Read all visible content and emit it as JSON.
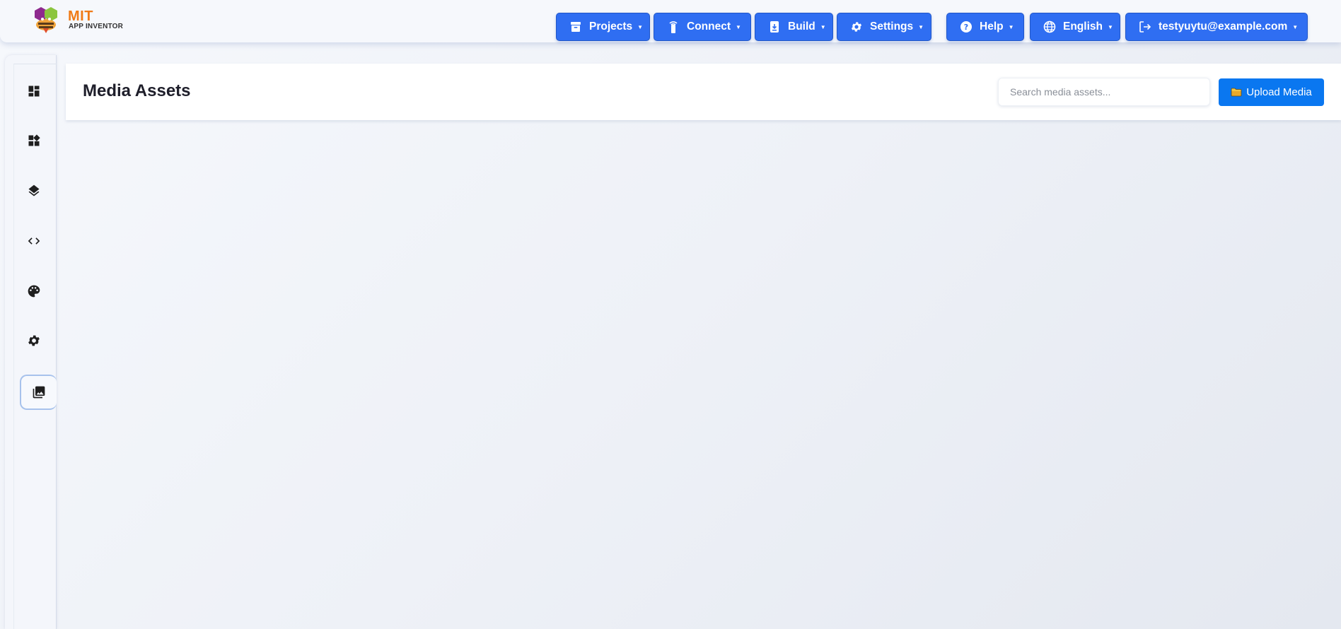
{
  "app": {
    "logo_title": "MIT",
    "logo_subtitle": "APP INVENTOR"
  },
  "topnav": {
    "projects": "Projects",
    "connect": "Connect",
    "build": "Build",
    "settings": "Settings",
    "help": "Help",
    "language": "English",
    "account": "testyuytu@example.com",
    "caret": "▼"
  },
  "sidebar": {
    "items": [
      {
        "name": "dashboard-icon"
      },
      {
        "name": "widgets-icon"
      },
      {
        "name": "layers-icon"
      },
      {
        "name": "code-icon"
      },
      {
        "name": "palette-icon"
      },
      {
        "name": "gear-icon"
      },
      {
        "name": "media-library-icon",
        "active": true
      }
    ]
  },
  "main": {
    "title": "Media Assets",
    "search_placeholder": "Search media assets...",
    "upload_label": "Upload Media"
  },
  "colors": {
    "nav_button": "#2f6ef2",
    "upload_button": "#0a77f0",
    "logo_orange": "#f07b17"
  }
}
